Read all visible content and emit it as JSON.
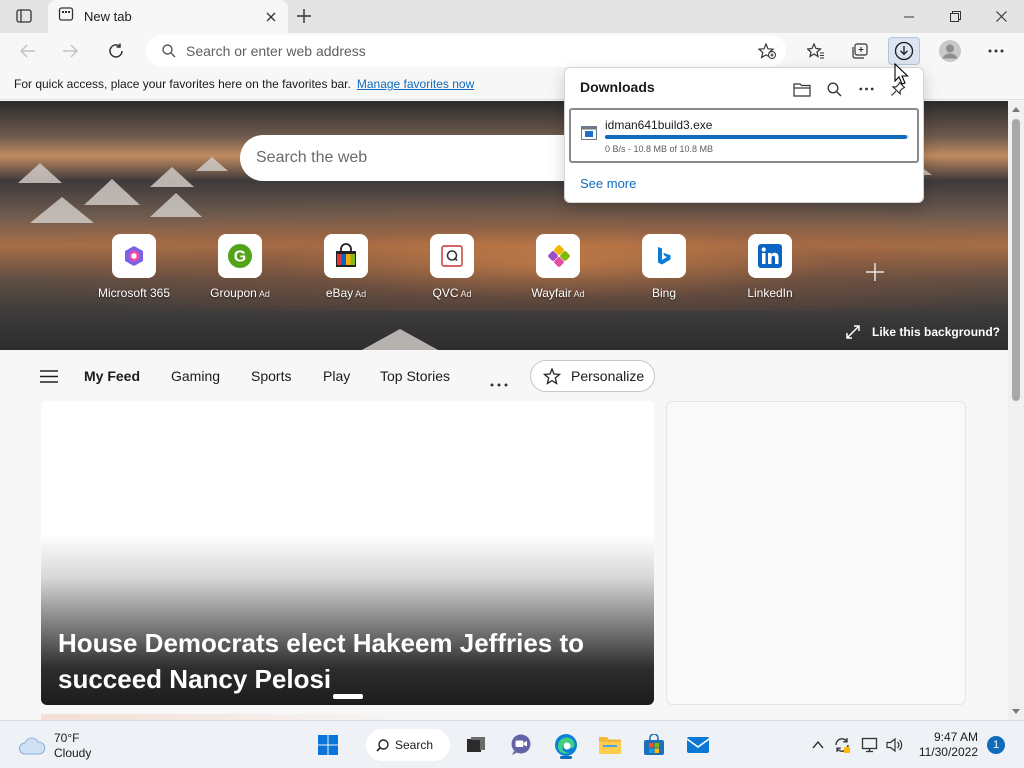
{
  "browser": {
    "tab_title": "New tab",
    "address_placeholder": "Search or enter web address"
  },
  "favorites_bar": {
    "message": "For quick access, place your favorites here on the favorites bar.",
    "link": "Manage favorites now"
  },
  "hero": {
    "search_placeholder": "Search the web",
    "like_background": "Like this background?"
  },
  "tiles": [
    {
      "label": "Microsoft 365",
      "ad": "",
      "icon": "microsoft365-icon"
    },
    {
      "label": "Groupon",
      "ad": "Ad",
      "icon": "groupon-icon"
    },
    {
      "label": "eBay",
      "ad": "Ad",
      "icon": "ebay-icon"
    },
    {
      "label": "QVC",
      "ad": "Ad",
      "icon": "qvc-icon"
    },
    {
      "label": "Wayfair",
      "ad": "Ad",
      "icon": "wayfair-icon"
    },
    {
      "label": "Bing",
      "ad": "",
      "icon": "bing-icon"
    },
    {
      "label": "LinkedIn",
      "ad": "",
      "icon": "linkedin-icon"
    }
  ],
  "feed": {
    "items": [
      "My Feed",
      "Gaming",
      "Sports",
      "Play",
      "Top Stories"
    ],
    "personalize": "Personalize",
    "headline": "House Democrats elect Hakeem Jeffries to succeed Nancy Pelosi"
  },
  "downloads": {
    "title": "Downloads",
    "file_name": "idman641build3.exe",
    "status": "0 B/s - 10.8 MB of 10.8 MB",
    "progress_fraction": 0.995,
    "see_more": "See more"
  },
  "taskbar": {
    "temperature": "70°F",
    "condition": "Cloudy",
    "search_label": "Search",
    "time": "9:47 AM",
    "date": "11/30/2022",
    "notification_count": "1"
  },
  "colors": {
    "accent": "#0f6cbd",
    "edge_blue": "#0078d4"
  }
}
